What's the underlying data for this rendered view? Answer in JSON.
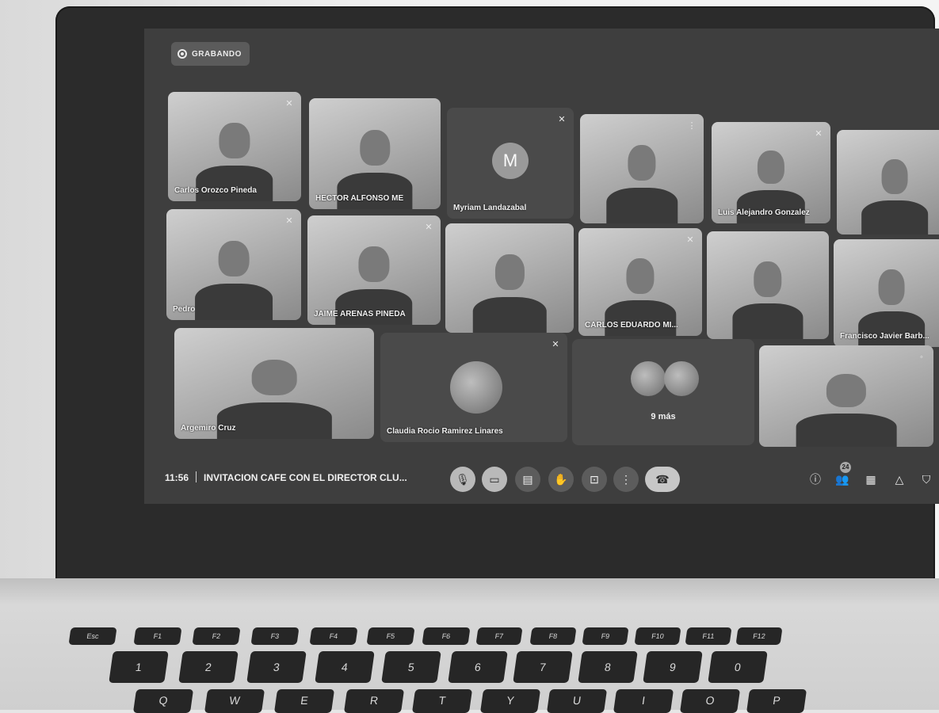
{
  "recording_label": "GRABANDO",
  "participants": [
    {
      "name": "Carlos Orozco Pineda",
      "kind": "video"
    },
    {
      "name": "HECTOR ALFONSO ME",
      "kind": "video"
    },
    {
      "name": "Myriam Landazabal",
      "kind": "avatar",
      "initial": "M"
    },
    {
      "name": "",
      "kind": "video"
    },
    {
      "name": "Luis Alejandro Gonzalez",
      "kind": "video"
    },
    {
      "name": "",
      "kind": "video"
    },
    {
      "name": "Pedro",
      "kind": "video"
    },
    {
      "name": "JAIME ARENAS PINEDA",
      "kind": "video"
    },
    {
      "name": "",
      "kind": "video"
    },
    {
      "name": "CARLOS EDUARDO MI...",
      "kind": "video"
    },
    {
      "name": "",
      "kind": "video"
    },
    {
      "name": "Francisco Javier Barb...",
      "kind": "video"
    },
    {
      "name": "Argemiro Cruz",
      "kind": "video"
    },
    {
      "name": "Claudia Rocio Ramirez Linares",
      "kind": "avatar-photo"
    },
    {
      "name": "9 más",
      "kind": "overflow"
    },
    {
      "name": "",
      "kind": "video"
    }
  ],
  "toolbar": {
    "time": "11:56",
    "meeting_title": "INVITACION CAFE CON EL DIRECTOR CLU...",
    "participant_count": "24"
  },
  "keyboard": {
    "function_row": [
      "Esc",
      "F1",
      "F2",
      "F3",
      "F4",
      "F5",
      "F6",
      "F7",
      "F8",
      "F9",
      "F10",
      "F11",
      "F12"
    ],
    "number_row": [
      "1",
      "2",
      "3",
      "4",
      "5",
      "6",
      "7",
      "8",
      "9",
      "0"
    ],
    "letter_row": [
      "Q",
      "W",
      "E",
      "R",
      "T",
      "Y",
      "U",
      "I",
      "O",
      "P"
    ]
  }
}
